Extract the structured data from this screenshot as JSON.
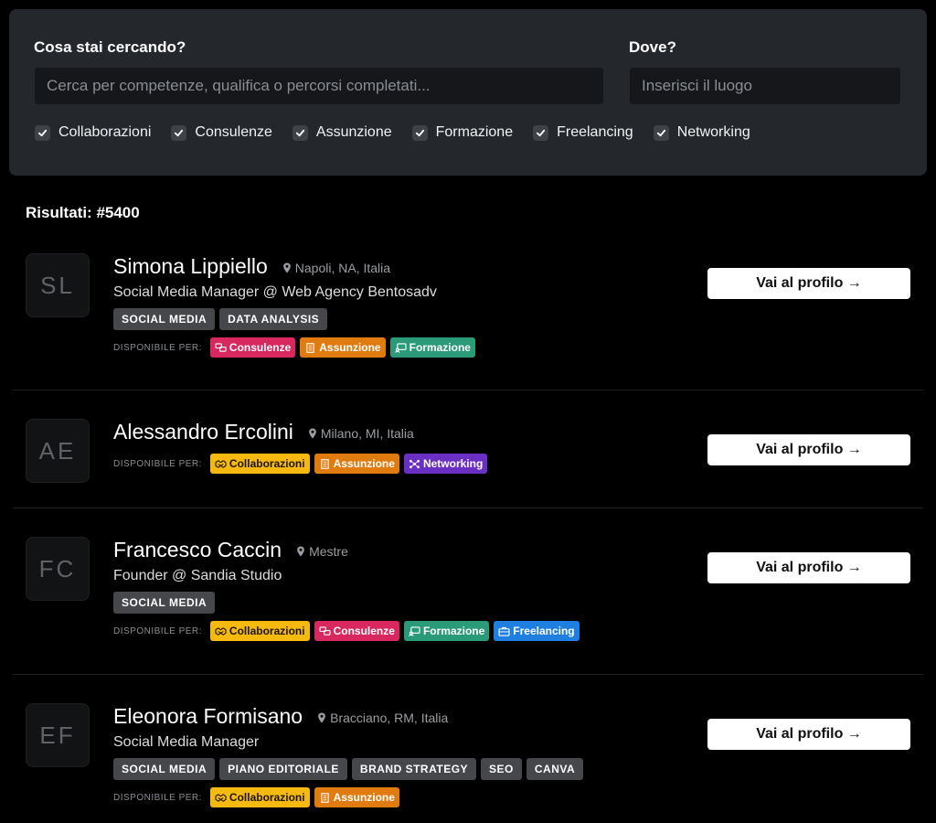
{
  "search": {
    "what_label": "Cosa stai cercando?",
    "what_placeholder": "Cerca per competenze, qualifica o percorsi completati...",
    "where_label": "Dove?",
    "where_placeholder": "Inserisci il luogo",
    "filters": [
      {
        "label": "Collaborazioni",
        "checked": true
      },
      {
        "label": "Consulenze",
        "checked": true
      },
      {
        "label": "Assunzione",
        "checked": true
      },
      {
        "label": "Formazione",
        "checked": true
      },
      {
        "label": "Freelancing",
        "checked": true
      },
      {
        "label": "Networking",
        "checked": true
      }
    ]
  },
  "results": {
    "count_label": "Risultati: #5400",
    "available_label": "DISPONIBILE PER:",
    "profile_button_label": "Vai al profilo →",
    "items": [
      {
        "initials": "SL",
        "name": "Simona Lippiello",
        "location": "Napoli, NA, Italia",
        "role": "Social Media Manager @ Web Agency Bentosadv",
        "skills": [
          "SOCIAL MEDIA",
          "DATA ANALYSIS"
        ],
        "available": [
          "Consulenze",
          "Assunzione",
          "Formazione"
        ]
      },
      {
        "initials": "AE",
        "name": "Alessandro Ercolini",
        "location": "Milano, MI, Italia",
        "available": [
          "Collaborazioni",
          "Assunzione",
          "Networking"
        ]
      },
      {
        "initials": "FC",
        "name": "Francesco Caccin",
        "location": "Mestre",
        "role": "Founder @ Sandia Studio",
        "skills": [
          "SOCIAL MEDIA"
        ],
        "available": [
          "Collaborazioni",
          "Consulenze",
          "Formazione",
          "Freelancing"
        ]
      },
      {
        "initials": "EF",
        "name": "Eleonora Formisano",
        "location": "Bracciano, RM, Italia",
        "role": "Social Media Manager",
        "skills": [
          "SOCIAL MEDIA",
          "PIANO EDITORIALE",
          "BRAND STRATEGY",
          "SEO",
          "CANVA"
        ],
        "available": [
          "Collaborazioni",
          "Assunzione"
        ]
      }
    ]
  },
  "colors": {
    "collaborazioni": "#f5b90f",
    "consulenze": "#d8285f",
    "assunzione": "#e07b10",
    "formazione": "#2b9a78",
    "networking": "#6a30c4",
    "freelancing": "#1f7fe0"
  }
}
